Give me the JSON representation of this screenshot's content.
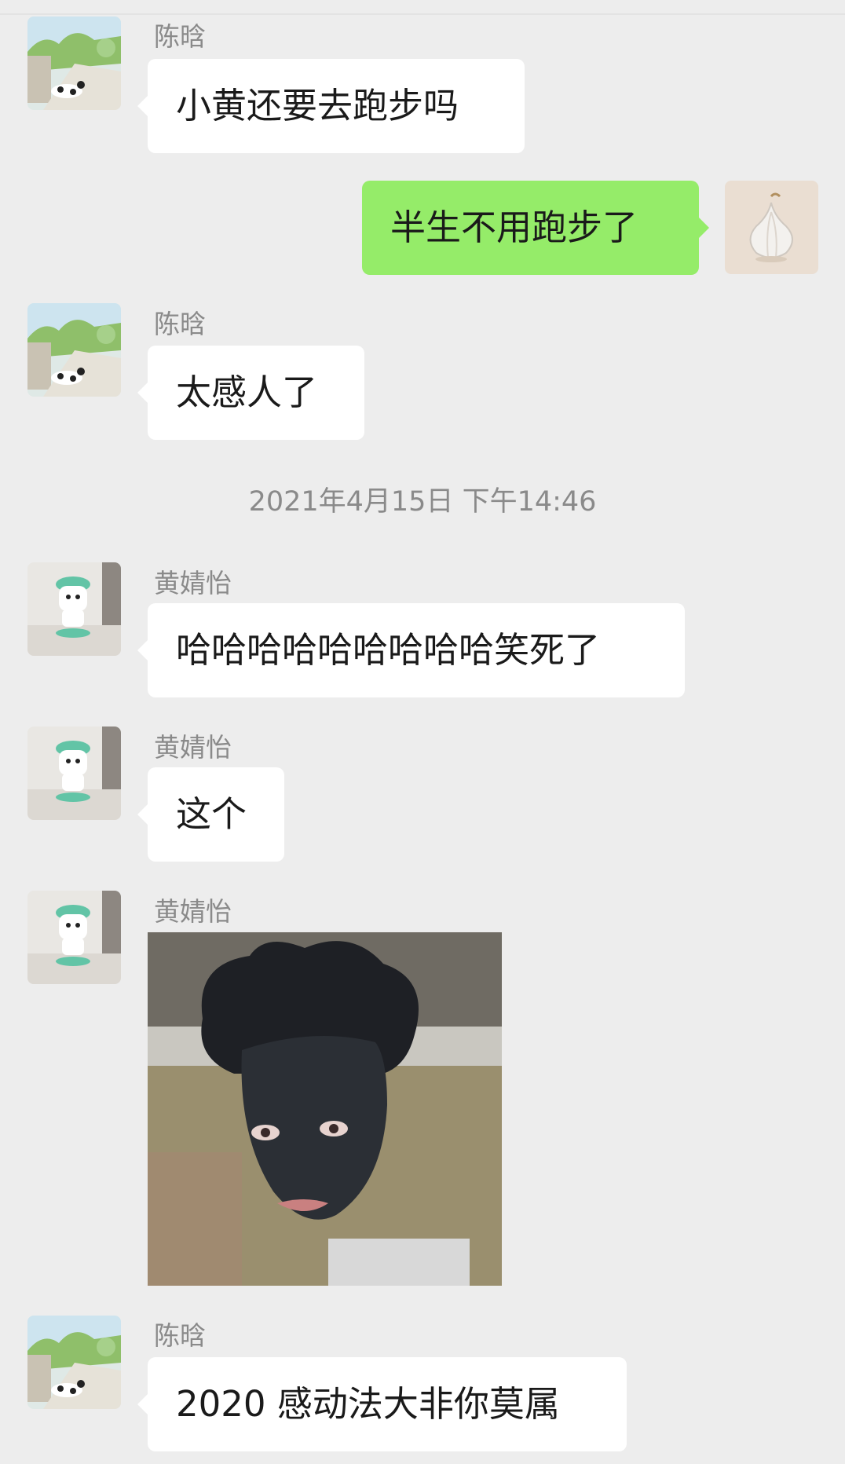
{
  "conversation": {
    "messages": [
      {
        "sender": "陈晗",
        "side": "in",
        "avatar": "landscape-cat-avatar",
        "text": "小黄还要去跑步吗"
      },
      {
        "sender": "",
        "side": "out",
        "avatar": "garlic-avatar",
        "text": "半生不用跑步了"
      },
      {
        "sender": "陈晗",
        "side": "in",
        "avatar": "landscape-cat-avatar",
        "text": "太感人了"
      },
      {
        "sender": "黄婧怡",
        "side": "in",
        "avatar": "pochacco-avatar",
        "text": "哈哈哈哈哈哈哈哈哈笑死了"
      },
      {
        "sender": "黄婧怡",
        "side": "in",
        "avatar": "pochacco-avatar",
        "text": "这个"
      },
      {
        "sender": "黄婧怡",
        "side": "in",
        "avatar": "pochacco-avatar",
        "type": "image",
        "image": "face-meme-photo"
      },
      {
        "sender": "陈晗",
        "side": "in",
        "avatar": "landscape-cat-avatar",
        "text": "2020 感动法大非你莫属"
      }
    ],
    "timestamp": "2021年4月15日 下午14:46"
  },
  "colors": {
    "background": "#ededed",
    "incoming_bubble": "#ffffff",
    "outgoing_bubble": "#95ec69",
    "sender_name": "#8a8a8a",
    "timestamp_text": "#8a8a8a",
    "message_text": "#1a1a1a"
  }
}
